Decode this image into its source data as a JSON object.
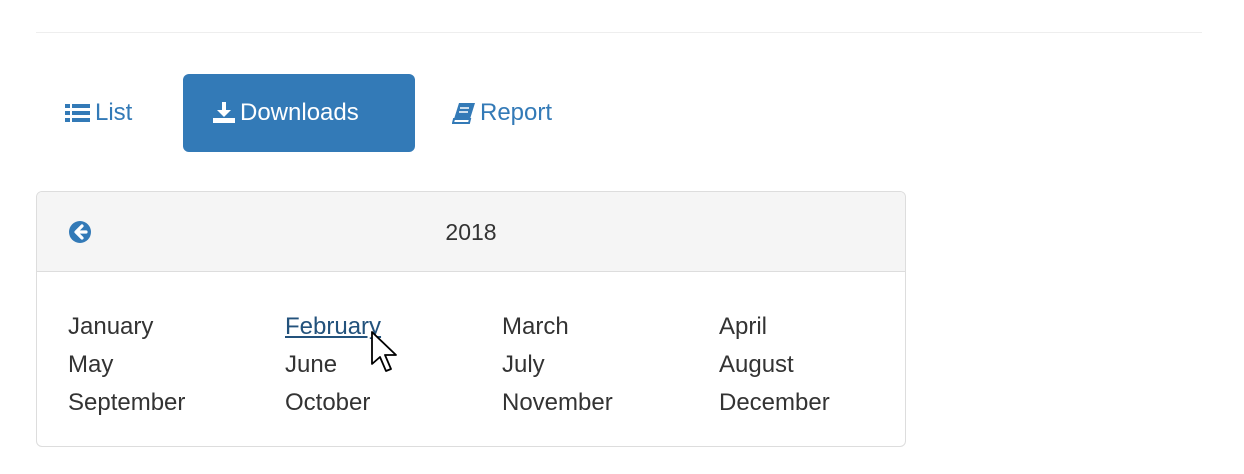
{
  "tabs": [
    {
      "label": "List",
      "icon": "list-icon",
      "active": false
    },
    {
      "label": "Downloads",
      "icon": "download-icon",
      "active": true
    },
    {
      "label": "Report",
      "icon": "book-icon",
      "active": false
    }
  ],
  "calendar": {
    "year": "2018",
    "back_icon": "circle-arrow-left-icon",
    "months": [
      "January",
      "February",
      "March",
      "April",
      "May",
      "June",
      "July",
      "August",
      "September",
      "October",
      "November",
      "December"
    ],
    "hovered_month": "February"
  },
  "colors": {
    "accent": "#337ab7",
    "link_hover": "#23527c",
    "panel_heading_bg": "#f5f5f5",
    "border": "#dddddd",
    "text": "#333333"
  }
}
